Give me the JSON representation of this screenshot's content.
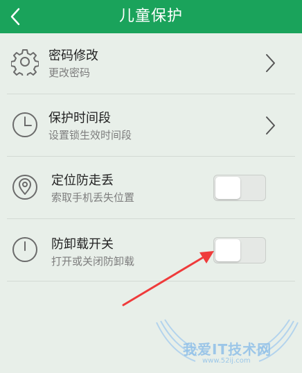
{
  "header": {
    "title": "儿童保护",
    "back_icon": "chevron-left-icon",
    "background_color": "#1aa35b"
  },
  "settings": [
    {
      "key": "change_password",
      "title": "密码修改",
      "subtitle": "更改密码",
      "icon": "gear-icon",
      "control": "chevron"
    },
    {
      "key": "protect_period",
      "title": "保护时间段",
      "subtitle": "设置锁生效时间段",
      "icon": "clock-icon",
      "control": "chevron"
    },
    {
      "key": "locate_antilost",
      "title": "定位防走丢",
      "subtitle": "索取手机丢失位置",
      "icon": "location-pin-icon",
      "control": "toggle",
      "enabled": false
    },
    {
      "key": "anti_uninstall",
      "title": "防卸载开关",
      "subtitle": "打开或关闭防卸载",
      "icon": "power-icon",
      "control": "toggle",
      "enabled": false
    }
  ],
  "annotation": {
    "type": "red-arrow",
    "color": "#ef3b3b",
    "points_to": "anti_uninstall toggle"
  },
  "watermark": {
    "text": "我爱IT技术网",
    "url": "www.52ij.com",
    "color": "#8fc0e8"
  }
}
